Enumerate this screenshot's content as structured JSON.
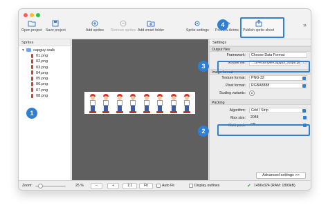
{
  "toolbar": {
    "open_project": "Open project",
    "save_project": "Save project",
    "add_sprites": "Add sprites",
    "remove_sprites": "Remove sprites",
    "add_smart_folder": "Add smart folder",
    "sprite_settings": "Sprite settings",
    "preview_anims": "Preview Anims",
    "publish": "Publish sprite sheet",
    "more": "»"
  },
  "sidebar": {
    "title": "Sprites",
    "root": "capguy-walk",
    "items": [
      "01.png",
      "02.png",
      "03.png",
      "04.png",
      "05.png",
      "06.png",
      "07.png",
      "08.png"
    ]
  },
  "canvas": {
    "frame_count": 8
  },
  "settings": {
    "title": "Settings",
    "output_files": {
      "heading": "Output files",
      "framework_label": "Framework:",
      "framework_value": "Choose Data Format",
      "texture_label": "Texture file:",
      "texture_value": "…ut-example/capguy_strip8.png"
    },
    "image_format": {
      "heading": "Image format",
      "texture_format_label": "Texture format:",
      "texture_format_value": "PNG-32",
      "pixel_format_label": "Pixel format:",
      "pixel_format_value": "RGBA8888",
      "scaling_label": "Scaling variants:"
    },
    "packing": {
      "heading": "Packing",
      "algorithm_label": "Algorithm:",
      "algorithm_value": "Grid / Strip",
      "max_size_label": "Max size:",
      "max_size_value": "2048",
      "multi_pack_label": "Multi pack:",
      "multi_pack_value": "Off"
    },
    "advanced_button": "Advanced settings >>"
  },
  "statusbar": {
    "zoom_label": "Zoom:",
    "zoom_value": "25 %",
    "minus": "–",
    "plus": "+",
    "one_to_one": "1:1",
    "fit": "Fit",
    "auto_fit": "Auto Fit",
    "display_outlines": "Display outlines",
    "check": "✔",
    "size_info": "1496x324 (RAM: 1893kB)"
  },
  "callouts": {
    "one": "1",
    "two": "2",
    "three": "3",
    "four": "4"
  },
  "colors": {
    "accent": "#2f7fd3",
    "canvas_bg": "#5f5f5f",
    "ok_green": "#2ea043"
  }
}
